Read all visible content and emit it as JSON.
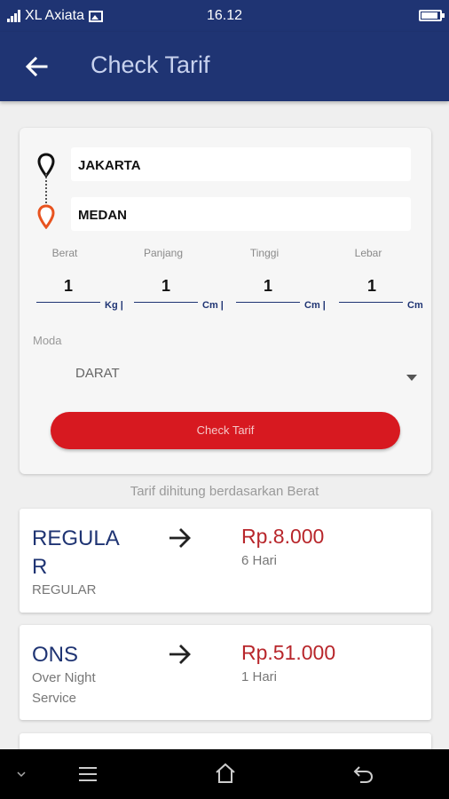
{
  "status_bar": {
    "carrier": "XL Axiata",
    "time": "16.12",
    "battery_level": 0.9
  },
  "app_bar": {
    "title": "Check Tarif"
  },
  "form": {
    "origin": "JAKARTA",
    "destination": "MEDAN",
    "dimensions": [
      {
        "label": "Berat",
        "value": "1",
        "unit": "Kg |"
      },
      {
        "label": "Panjang",
        "value": "1",
        "unit": "Cm |"
      },
      {
        "label": "Tinggi",
        "value": "1",
        "unit": "Cm |"
      },
      {
        "label": "Lebar",
        "value": "1",
        "unit": "Cm"
      }
    ],
    "moda_label": "Moda",
    "moda_value": "DARAT",
    "check_button": "Check Tarif"
  },
  "note": "Tarif dihitung berdasarkan Berat",
  "services": [
    {
      "name": "REGULA R",
      "sub": "REGULAR",
      "price": "Rp.8.000",
      "days": "6 Hari"
    },
    {
      "name": "ONS",
      "sub": "Over Night Service",
      "price": "Rp.51.000",
      "days": "1 Hari"
    }
  ],
  "colors": {
    "primary": "#1f3473",
    "accent": "#d71920",
    "price": "#b8262b"
  },
  "icons": [
    "back-arrow-icon",
    "origin-pin-icon",
    "destination-pin-icon",
    "dropdown-arrow-icon",
    "right-arrow-icon",
    "menu-icon",
    "home-icon",
    "back-icon"
  ]
}
